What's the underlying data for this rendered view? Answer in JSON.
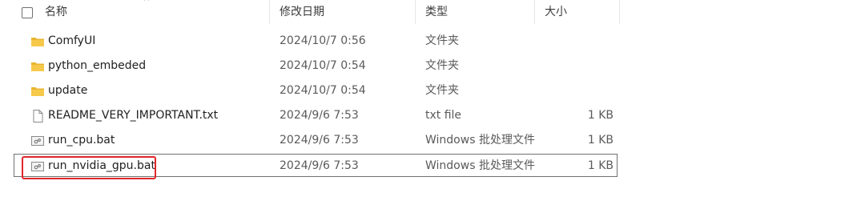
{
  "header": {
    "name": "名称",
    "date": "修改日期",
    "type": "类型",
    "size": "大小"
  },
  "files": [
    {
      "icon": "folder-icon",
      "name": "ComfyUI",
      "date": "2024/10/7 0:56",
      "type": "文件夹",
      "size": ""
    },
    {
      "icon": "folder-icon",
      "name": "python_embeded",
      "date": "2024/10/7 0:54",
      "type": "文件夹",
      "size": ""
    },
    {
      "icon": "folder-icon",
      "name": "update",
      "date": "2024/10/7 0:54",
      "type": "文件夹",
      "size": ""
    },
    {
      "icon": "text-file-icon",
      "name": "README_VERY_IMPORTANT.txt",
      "date": "2024/9/6 7:53",
      "type": "txt file",
      "size": "1 KB"
    },
    {
      "icon": "batch-file-icon",
      "name": "run_cpu.bat",
      "date": "2024/9/6 7:53",
      "type": "Windows 批处理文件",
      "size": "1 KB"
    },
    {
      "icon": "batch-file-icon",
      "name": "run_nvidia_gpu.bat",
      "date": "2024/9/6 7:53",
      "type": "Windows 批处理文件",
      "size": "1 KB",
      "selected": true
    }
  ],
  "colors": {
    "folder": "#f4c542",
    "highlight": "#e0262b"
  }
}
